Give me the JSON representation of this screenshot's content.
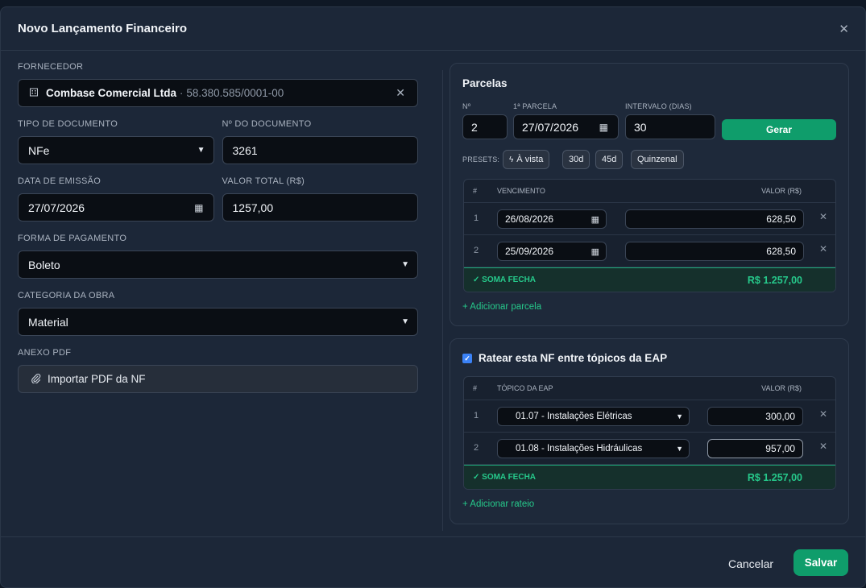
{
  "modal": {
    "title": "Novo Lançamento Financeiro"
  },
  "fornecedor": {
    "label": "FORNECEDOR",
    "name": "Combase Comercial Ltda",
    "sep": "·",
    "cnpj": "58.380.585/0001-00"
  },
  "tipo_doc": {
    "label": "TIPO DE DOCUMENTO",
    "value": "NFe"
  },
  "num_doc": {
    "label": "Nº DO DOCUMENTO",
    "value": "3261"
  },
  "data_emissao": {
    "label": "DATA DE EMISSÃO",
    "value": "27/07/2026"
  },
  "valor_total": {
    "label": "VALOR TOTAL (R$)",
    "value": "1257,00"
  },
  "forma_pagamento": {
    "label": "FORMA DE PAGAMENTO",
    "value": "Boleto"
  },
  "categoria": {
    "label": "CATEGORIA DA OBRA",
    "value": "Material"
  },
  "anexo": {
    "label": "ANEXO PDF",
    "button": "Importar PDF da NF"
  },
  "parcelas": {
    "title": "Parcelas",
    "n_label": "Nº",
    "n_value": "2",
    "first_label": "1ª PARCELA",
    "first_value": "27/07/2026",
    "interval_label": "INTERVALO (DIAS)",
    "interval_value": "30",
    "generate": "Gerar",
    "presets_label": "PRESETS:",
    "presets": [
      "À vista",
      "30d",
      "45d",
      "Quinzenal"
    ],
    "col_hash": "#",
    "col_due": "VENCIMENTO",
    "col_value": "VALOR (R$)",
    "rows": [
      {
        "n": "1",
        "due": "26/08/2026",
        "value": "628,50"
      },
      {
        "n": "2",
        "due": "25/09/2026",
        "value": "628,50"
      }
    ],
    "sum_label": "✓ SOMA FECHA",
    "sum_value": "R$ 1.257,00",
    "add": "+ Adicionar parcela"
  },
  "rateio": {
    "title": "Ratear esta NF entre tópicos da EAP",
    "checked": true,
    "col_hash": "#",
    "col_topic": "TÓPICO DA EAP",
    "col_value": "VALOR (R$)",
    "rows": [
      {
        "n": "1",
        "topic": "01.07 - Instalações Elétricas",
        "value": "300,00"
      },
      {
        "n": "2",
        "topic": "01.08 - Instalações Hidráulicas",
        "value": "957,00"
      }
    ],
    "sum_label": "✓ SOMA FECHA",
    "sum_value": "R$ 1.257,00",
    "add": "+ Adicionar rateio"
  },
  "footer": {
    "cancel": "Cancelar",
    "save": "Salvar"
  },
  "colors": {
    "accent": "#0f9d6b",
    "success_text": "#26c98b",
    "checkbox": "#3b82f6"
  }
}
